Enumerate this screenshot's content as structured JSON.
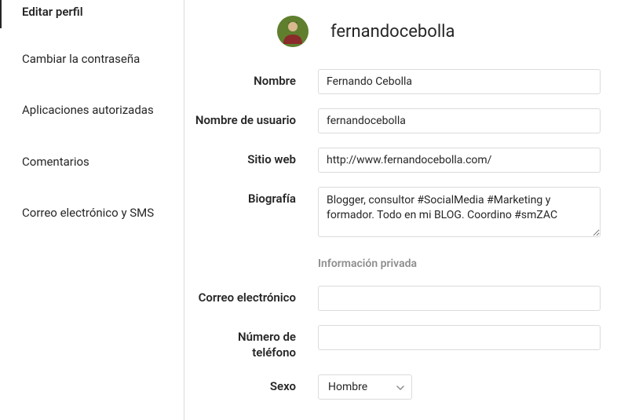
{
  "sidebar": {
    "items": [
      {
        "label": "Editar perfil"
      },
      {
        "label": "Cambiar la contraseña"
      },
      {
        "label": "Aplicaciones autorizadas"
      },
      {
        "label": "Comentarios"
      },
      {
        "label": "Correo electrónico y SMS"
      }
    ]
  },
  "header": {
    "username": "fernandocebolla"
  },
  "labels": {
    "name": "Nombre",
    "username": "Nombre de usuario",
    "website": "Sitio web",
    "bio": "Biografía",
    "privateInfo": "Información privada",
    "email": "Correo electrónico",
    "phone": "Número de teléfono",
    "gender": "Sexo"
  },
  "values": {
    "name": "Fernando Cebolla",
    "username": "fernandocebolla",
    "website": "http://www.fernandocebolla.com/",
    "bio": "Blogger, consultor #SocialMedia #Marketing y formador. Todo en mi BLOG. Coordino #smZAC",
    "email": "",
    "phone": "",
    "gender": "Hombre"
  }
}
